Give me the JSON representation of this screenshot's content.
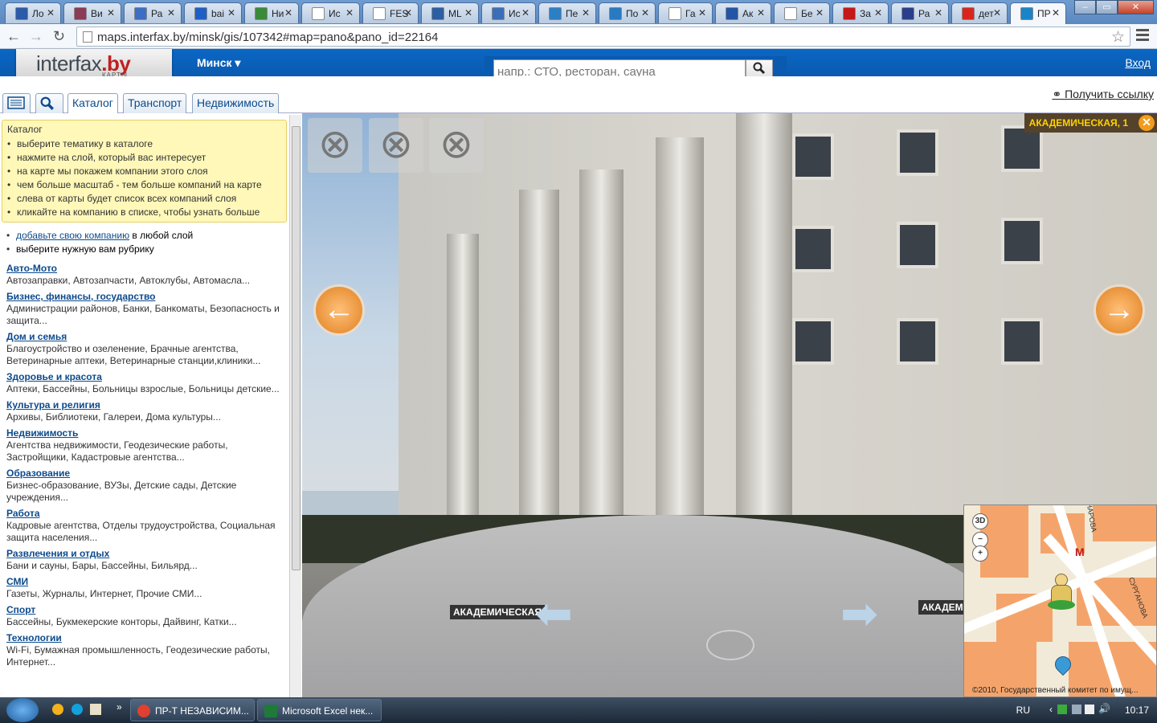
{
  "browser": {
    "tabs": [
      {
        "label": "Ло",
        "favicon_color": "#2b5aa8"
      },
      {
        "label": "Ви",
        "favicon_color": "#8a3b55"
      },
      {
        "label": "Ра",
        "favicon_color": "#3c6fc3"
      },
      {
        "label": "bai",
        "favicon_color": "#1e5fc4"
      },
      {
        "label": "Ни",
        "favicon_color": "#3a8a3a"
      },
      {
        "label": "Ис",
        "favicon_color": "#ffffff"
      },
      {
        "label": "FES",
        "favicon_color": "#ffffff"
      },
      {
        "label": "ML",
        "favicon_color": "#2c5fa1"
      },
      {
        "label": "Ис",
        "favicon_color": "#3a6fb8"
      },
      {
        "label": "Пе",
        "favicon_color": "#2d7fc4"
      },
      {
        "label": "По",
        "favicon_color": "#2a79c3"
      },
      {
        "label": "Га",
        "favicon_color": "#ffffff"
      },
      {
        "label": "Ак",
        "favicon_color": "#2454a4"
      },
      {
        "label": "Бе",
        "favicon_color": "#ffffff"
      },
      {
        "label": "За",
        "favicon_color": "#c51818"
      },
      {
        "label": "Ра",
        "favicon_color": "#2a3f8c"
      },
      {
        "label": "дет",
        "favicon_color": "#d9261c"
      },
      {
        "label": "ПР",
        "favicon_color": "#1b84c9"
      }
    ],
    "url": "maps.interfax.by/minsk/gis/107342#map=pano&pano_id=22164"
  },
  "header": {
    "logo_main": "interfax",
    "logo_suffix": ".by",
    "logo_sub": "КАРТЫ",
    "city": "Минск ▾",
    "search_placeholder": "напр.: СТО, ресторан, сауна",
    "login": "Вход"
  },
  "tabs": {
    "catalog": "Каталог",
    "transport": "Транспорт",
    "realty": "Недвижимость",
    "get_link": "Получить ссылку"
  },
  "hint": {
    "title": "Каталог",
    "items": [
      "выберите тематику в каталоге",
      "нажмите на слой, который вас интересует",
      "на карте мы покажем компании этого слоя",
      "чем больше масштаб - тем больше компаний на карте",
      "слева от карты будет список всех компаний слоя",
      "кликайте на компанию в списке, чтобы узнать больше"
    ]
  },
  "add": {
    "link": "добавьте свою компанию",
    "link_tail": " в любой слой",
    "second": "выберите нужную вам рубрику"
  },
  "categories": [
    {
      "title": "Авто-Мото",
      "desc": "Автозаправки, Автозапчасти, Автоклубы, Автомасла..."
    },
    {
      "title": "Бизнес, финансы, государство",
      "desc": "Администрации районов, Банки, Банкоматы, Безопасность и защита..."
    },
    {
      "title": "Дом и семья",
      "desc": "Благоустройство и озеленение, Брачные агентства, Ветеринарные аптеки, Ветеринарные станции,клиники..."
    },
    {
      "title": "Здоровье и красота",
      "desc": "Аптеки, Бассейны, Больницы взрослые, Больницы детские..."
    },
    {
      "title": "Культура и религия",
      "desc": "Архивы, Библиотеки, Галереи, Дома культуры..."
    },
    {
      "title": "Недвижимость",
      "desc": "Агентства недвижимости, Геодезические работы, Застройщики, Кадастровые агентства..."
    },
    {
      "title": "Образование",
      "desc": "Бизнес-образование, ВУЗы, Детские сады, Детские учреждения..."
    },
    {
      "title": "Работа",
      "desc": "Кадровые агентства, Отделы трудоустройства, Социальная защита населения..."
    },
    {
      "title": "Развлечения и отдых",
      "desc": "Бани и сауны, Бары, Бассейны, Бильярд..."
    },
    {
      "title": "СМИ",
      "desc": "Газеты, Журналы, Интернет, Прочие СМИ..."
    },
    {
      "title": "Спорт",
      "desc": "Бассейны, Букмекерские конторы, Дайвинг, Катки..."
    },
    {
      "title": "Технологии",
      "desc": "Wi-Fi, Бумажная промышленность, Геодезические работы, Интернет..."
    }
  ],
  "pano": {
    "address": "АКАДЕМИЧЕСКАЯ, 1",
    "street_left": "АКАДЕМИЧЕСКАЯ",
    "street_right": "АКАДЕМИ",
    "close_buttons": [
      "⊗",
      "⊗",
      "⊗"
    ]
  },
  "minimap": {
    "btn_3d": "3D",
    "street_a": "СУРГАНОВА",
    "street_b": "НАРОВА",
    "metro": "М",
    "copyright": "©2010, Государственный комитет по имущ..."
  },
  "taskbar": {
    "items": [
      "ПР-Т НЕЗАВИСИМ...",
      "Microsoft Excel нек..."
    ],
    "lang": "RU",
    "time": "10:17"
  },
  "colors": {
    "header_blue": "#0a5ab0",
    "link": "#0c4a8c",
    "hint_bg": "#fff8b9",
    "accent_orange": "#f39b1c"
  }
}
